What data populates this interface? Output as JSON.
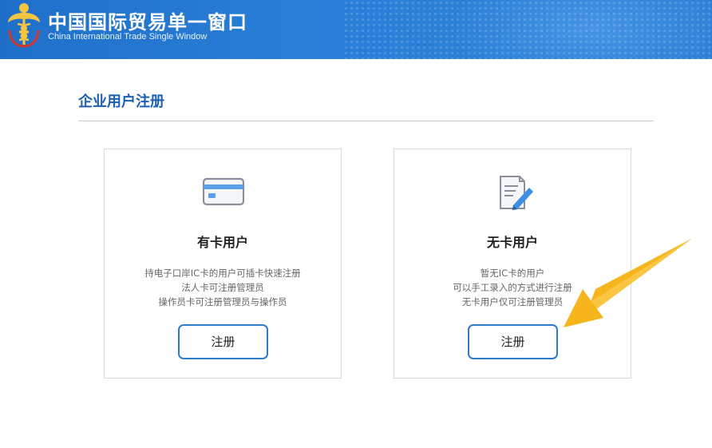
{
  "header": {
    "title_cn": "中国国际贸易单一窗口",
    "title_en": "China International Trade Single Window"
  },
  "page": {
    "title": "企业用户注册"
  },
  "cards": [
    {
      "title": "有卡用户",
      "icon": "card-icon",
      "desc": [
        "持电子口岸IC卡的用户可插卡快速注册",
        "法人卡可注册管理员",
        "操作员卡可注册管理员与操作员"
      ],
      "button_label": "注册"
    },
    {
      "title": "无卡用户",
      "icon": "document-edit-icon",
      "desc": [
        "暂无IC卡的用户",
        "可以手工录入的方式进行注册",
        "无卡用户仅可注册管理员"
      ],
      "button_label": "注册"
    }
  ],
  "colors": {
    "header_blue": "#2a80d8",
    "accent_blue": "#1a5fb0",
    "button_border": "#2f79c9",
    "arrow_orange": "#f5b41a"
  }
}
